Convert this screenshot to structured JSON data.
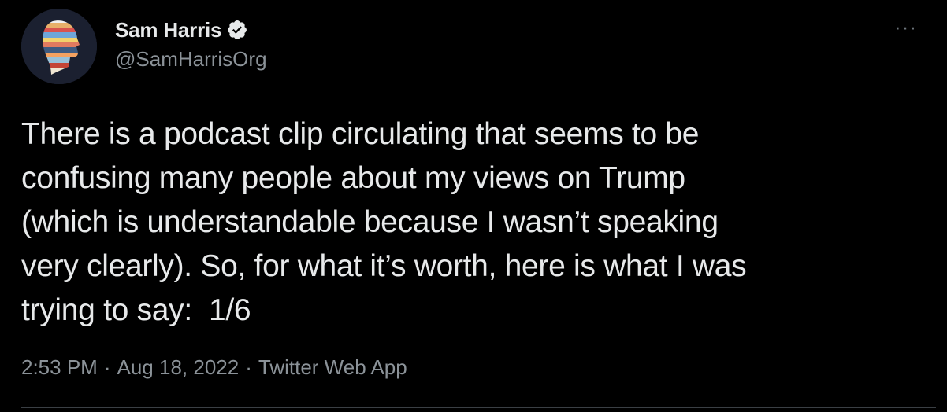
{
  "author": {
    "display_name": "Sam Harris",
    "handle": "@SamHarrisOrg",
    "verified_icon": "verified-badge-icon",
    "avatar_icon": "head-profile-avatar"
  },
  "menu": {
    "more_label": "···"
  },
  "tweet": {
    "text": "There is a podcast clip circulating that seems to be\nconfusing many people about my views on Trump\n(which is understandable because I wasn’t speaking\nvery clearly). So, for what it’s worth, here is what I was\ntrying to say:  1/6"
  },
  "meta": {
    "time": "2:53 PM",
    "separator": "·",
    "date": "Aug 18, 2022",
    "source": "Twitter Web App"
  },
  "colors": {
    "background": "#000000",
    "text_primary": "#e7e9ea",
    "text_secondary": "#8b9298"
  }
}
